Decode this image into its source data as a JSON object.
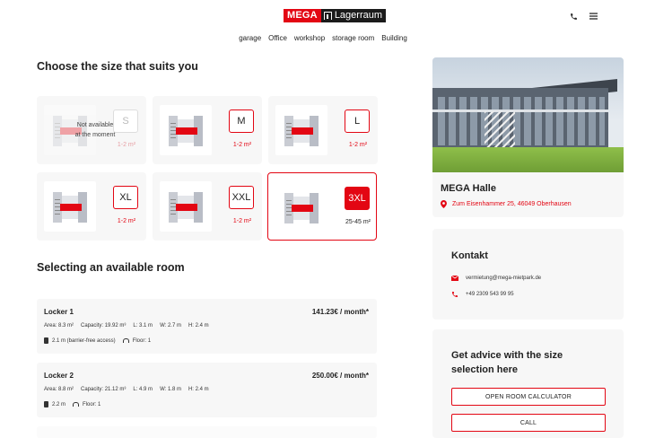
{
  "header": {
    "logo_left": "MEGA",
    "logo_right": "Lagerraum",
    "nav": [
      "garage",
      "Office",
      "workshop",
      "storage room",
      "Building"
    ]
  },
  "sizes_section": {
    "title": "Choose the size that suits you",
    "cards": [
      {
        "label": "S",
        "area": "1-2 m²",
        "available": false,
        "note_line1": "Not available",
        "note_line2": "at the moment"
      },
      {
        "label": "M",
        "area": "1-2 m²",
        "available": true
      },
      {
        "label": "L",
        "area": "1-2 m²",
        "available": true
      },
      {
        "label": "XL",
        "area": "1-2 m²",
        "available": true
      },
      {
        "label": "XXL",
        "area": "1-2 m²",
        "available": true
      },
      {
        "label": "3XL",
        "area": "25-45 m²",
        "available": true,
        "selected": true
      }
    ]
  },
  "rooms_section": {
    "title": "Selecting an available room",
    "rooms": [
      {
        "name": "Locker 1",
        "price": "141.23€ / month*",
        "area": "Area: 8.3 m²",
        "capacity": "Capacity: 19.92 m³",
        "l": "L: 3.1 m",
        "w": "W: 2.7 m",
        "h": "H: 2.4 m",
        "door": "2.1 m (barrier-free access)",
        "floor": "Floor: 1"
      },
      {
        "name": "Locker 2",
        "price": "250.00€ / month*",
        "area": "Area: 8.8 m²",
        "capacity": "Capacity: 21.12 m³",
        "l": "L: 4.9 m",
        "w": "W: 1.8 m",
        "h": "H: 2.4 m",
        "door": "2.2 m",
        "floor": "Floor: 1"
      }
    ]
  },
  "location": {
    "name": "MEGA Halle",
    "address": "Zum Eisenhammer 25, 46049 Oberhausen"
  },
  "contact": {
    "title": "Kontakt",
    "email": "vermietung@mega-mietpark.de",
    "phone": "+49 2309 543 99 95"
  },
  "advice": {
    "title_line1": "Get advice with the size",
    "title_line2": "selection here",
    "calc_button": "OPEN ROOM CALCULATOR",
    "call_button": "CALL"
  },
  "colors": {
    "accent": "#e30613",
    "card_bg": "#f7f7f7"
  }
}
